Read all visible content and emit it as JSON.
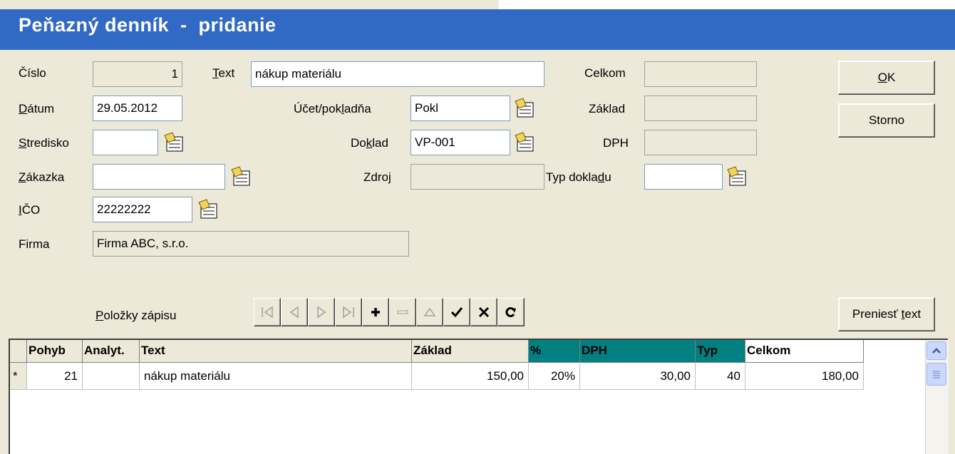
{
  "window": {
    "title": "Peňazný denník  -  pridanie"
  },
  "form": {
    "cislo": {
      "label": "Číslo",
      "value": "1"
    },
    "text": {
      "label": "Text",
      "value": "nákup materiálu"
    },
    "datum": {
      "label": "Dátum",
      "value": "29.05.2012"
    },
    "ucet": {
      "label": "Účet/pokladňa",
      "value": "Pokl"
    },
    "stredisko": {
      "label": "Stredisko",
      "value": ""
    },
    "doklad": {
      "label": "Doklad",
      "value": "VP-001"
    },
    "zakazka": {
      "label": "Zákazka",
      "value": ""
    },
    "zdroj": {
      "label": "Zdroj",
      "value": ""
    },
    "ico": {
      "label": "IČO",
      "value": "22222222"
    },
    "firma": {
      "label": "Firma",
      "value": "Firma ABC, s.r.o."
    },
    "celkom": {
      "label": "Celkom",
      "value": ""
    },
    "zaklad": {
      "label": "Základ",
      "value": ""
    },
    "dph": {
      "label": "DPH",
      "value": ""
    },
    "typ_dokladu": {
      "label": "Typ dokladu",
      "value": ""
    }
  },
  "buttons": {
    "ok": "OK",
    "storno": "Storno",
    "preniest": "Preniesť text"
  },
  "items_label": "Položky zápisu",
  "navigator": {
    "icons": [
      "first-icon",
      "prior-icon",
      "next-icon",
      "last-icon",
      "insert-icon",
      "delete-icon",
      "edit-icon",
      "post-icon",
      "cancel-icon",
      "refresh-icon"
    ]
  },
  "grid": {
    "columns": [
      "",
      "Pohyb",
      "Analyt.",
      "Text",
      "Základ",
      "%",
      "DPH",
      "Typ",
      "Celkom"
    ],
    "rows": [
      {
        "indicator": "*",
        "pohyb": "21",
        "analyt": "",
        "text": "nákup materiálu",
        "zaklad": "150,00",
        "pct": "20%",
        "dph": "30,00",
        "typ": "40",
        "celkom": "180,00"
      }
    ]
  },
  "colors": {
    "titlebar": "#3169c6",
    "teal_header": "#008080",
    "window_bg": "#ece9d8"
  }
}
